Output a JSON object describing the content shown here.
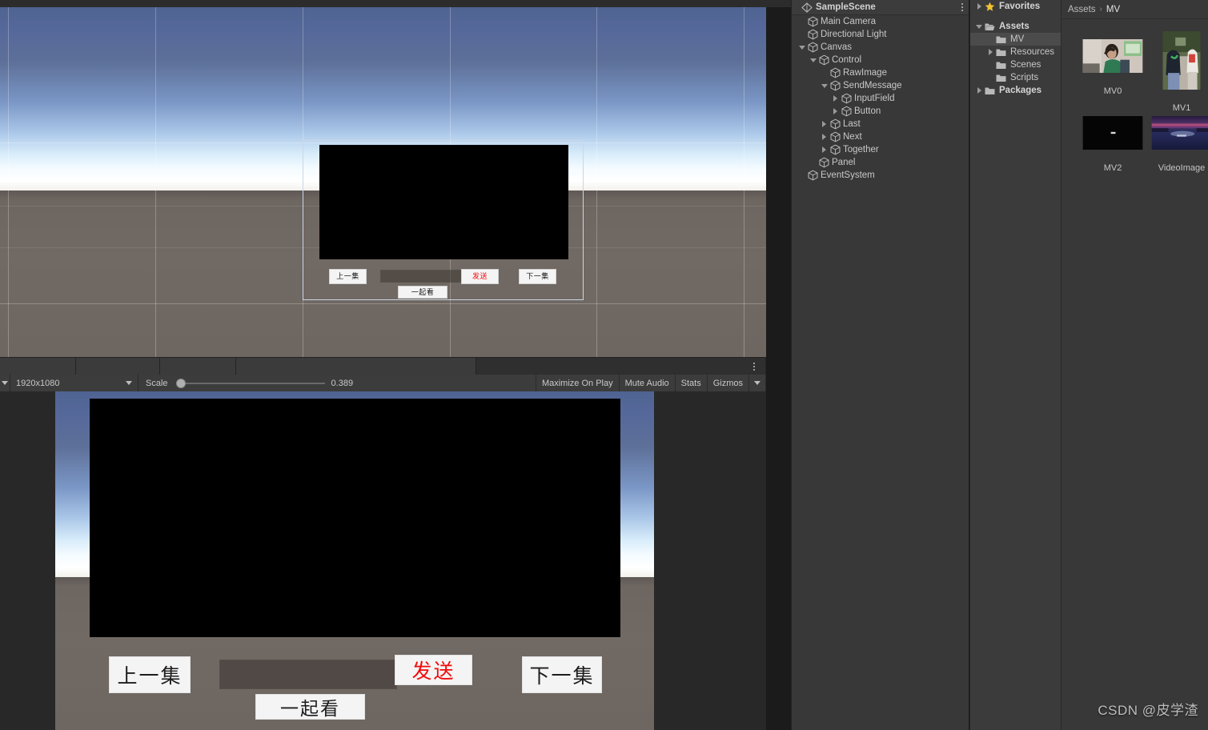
{
  "window": {
    "watermark": "CSDN @皮学渣"
  },
  "hierarchy": {
    "scene_name": "SampleScene",
    "kebab_icon": "more-options-icon",
    "items": [
      {
        "label": "Main Camera",
        "depth": 1,
        "twisty": "none",
        "icon": "gameobject-icon"
      },
      {
        "label": "Directional Light",
        "depth": 1,
        "twisty": "none",
        "icon": "gameobject-icon"
      },
      {
        "label": "Canvas",
        "depth": 1,
        "twisty": "down",
        "icon": "gameobject-icon"
      },
      {
        "label": "Control",
        "depth": 2,
        "twisty": "down",
        "icon": "gameobject-icon"
      },
      {
        "label": "RawImage",
        "depth": 3,
        "twisty": "none",
        "icon": "gameobject-icon"
      },
      {
        "label": "SendMessage",
        "depth": 3,
        "twisty": "down",
        "icon": "gameobject-icon"
      },
      {
        "label": "InputField",
        "depth": 4,
        "twisty": "right",
        "icon": "gameobject-icon"
      },
      {
        "label": "Button",
        "depth": 4,
        "twisty": "right",
        "icon": "gameobject-icon"
      },
      {
        "label": "Last",
        "depth": 3,
        "twisty": "right",
        "icon": "gameobject-icon"
      },
      {
        "label": "Next",
        "depth": 3,
        "twisty": "right",
        "icon": "gameobject-icon"
      },
      {
        "label": "Together",
        "depth": 3,
        "twisty": "right",
        "icon": "gameobject-icon"
      },
      {
        "label": "Panel",
        "depth": 2,
        "twisty": "none",
        "icon": "gameobject-icon"
      },
      {
        "label": "EventSystem",
        "depth": 1,
        "twisty": "none",
        "icon": "gameobject-icon"
      }
    ]
  },
  "project": {
    "tree": [
      {
        "label": "Favorites",
        "depth": 0,
        "twisty": "right",
        "icon": "star-icon",
        "bold": true,
        "selected": false
      },
      {
        "label": "Assets",
        "depth": 0,
        "twisty": "down",
        "icon": "folder-open-icon",
        "bold": true,
        "selected": false
      },
      {
        "label": "MV",
        "depth": 1,
        "twisty": "none",
        "icon": "folder-icon",
        "bold": false,
        "selected": true
      },
      {
        "label": "Resources",
        "depth": 1,
        "twisty": "right",
        "icon": "folder-icon",
        "bold": false,
        "selected": false
      },
      {
        "label": "Scenes",
        "depth": 1,
        "twisty": "none",
        "icon": "folder-icon",
        "bold": false,
        "selected": false
      },
      {
        "label": "Scripts",
        "depth": 1,
        "twisty": "none",
        "icon": "folder-icon",
        "bold": false,
        "selected": false
      },
      {
        "label": "Packages",
        "depth": 0,
        "twisty": "right",
        "icon": "folder-icon",
        "bold": true,
        "selected": false
      }
    ],
    "breadcrumb": {
      "root": "Assets",
      "separator": "›",
      "current": "MV"
    },
    "assets": [
      {
        "label": "MV0",
        "kind": "texture-thumbnail",
        "orientation": "landscape"
      },
      {
        "label": "MV1",
        "kind": "texture-thumbnail",
        "orientation": "portrait"
      },
      {
        "label": "MV2",
        "kind": "texture-thumbnail",
        "orientation": "landscape-dark"
      },
      {
        "label": "VideoImage",
        "kind": "texture-thumbnail",
        "orientation": "landscape-night"
      }
    ]
  },
  "game_toolbar": {
    "resolution": "1920x1080",
    "scale_label": "Scale",
    "scale_value": "0.389",
    "maximize_on_play": "Maximize On Play",
    "mute_audio": "Mute Audio",
    "stats": "Stats",
    "gizmos": "Gizmos"
  },
  "ui_canvas": {
    "prev_button": "上一集",
    "send_button": "发送",
    "next_button": "下一集",
    "together_button": "一起看",
    "input_value": "",
    "send_color": "#f20a0a"
  }
}
